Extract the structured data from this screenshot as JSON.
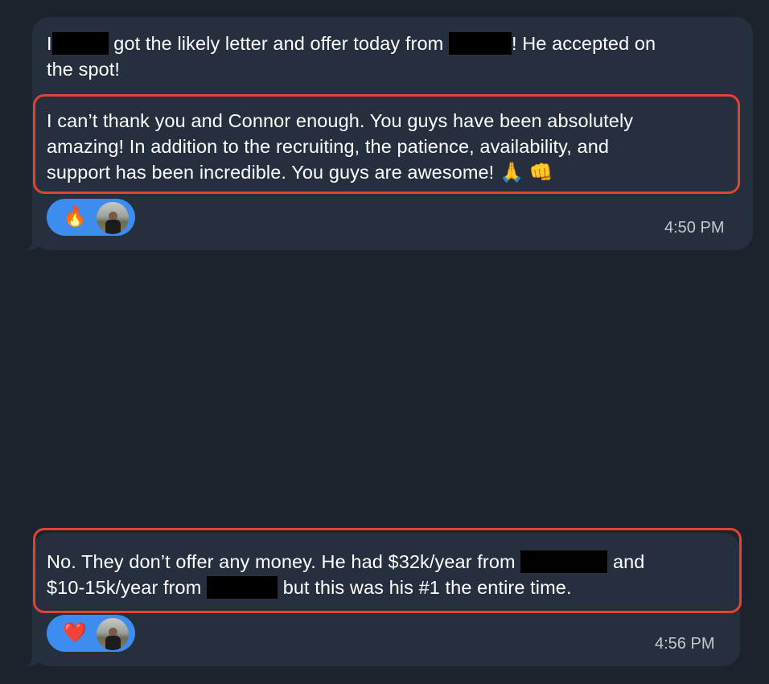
{
  "messages": [
    {
      "line1_a": "I",
      "line1_b": "got the likely letter and offer today from",
      "line1_c": "! He accepted on",
      "line2": "the spot!",
      "highlight_line1": "I can’t thank you and Connor enough. You guys have been absolutely",
      "highlight_line2": "amazing! In addition to the recruiting, the patience, availability, and",
      "highlight_line3": "support has been incredible. You guys are awesome!",
      "emojis": "🙏 👊",
      "reaction_emoji": "🔥",
      "time": "4:50 PM"
    },
    {
      "line1_a": "No. They don’t offer any money. He had $32k/year from",
      "line1_b": "and",
      "line2_a": "$10-15k/year from",
      "line2_b": "but this was his #1 the entire time.",
      "reaction_emoji": "❤️",
      "time": "4:56 PM"
    }
  ],
  "icons": {
    "reaction_avatar": "avatar-photo",
    "highlight_color": "#e0432f",
    "reaction_bg": "#3d8df0"
  }
}
